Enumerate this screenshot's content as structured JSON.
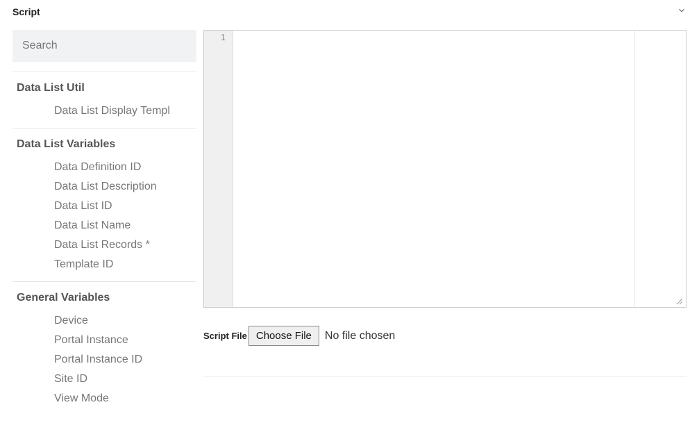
{
  "header": {
    "title": "Script"
  },
  "sidebar": {
    "search_placeholder": "Search",
    "groups": [
      {
        "title": "Data List Util",
        "items": [
          "Data List Display Templ"
        ]
      },
      {
        "title": "Data List Variables",
        "items": [
          "Data Definition ID",
          "Data List Description",
          "Data List ID",
          "Data List Name",
          "Data List Records *",
          "Template ID"
        ]
      },
      {
        "title": "General Variables",
        "items": [
          "Device",
          "Portal Instance",
          "Portal Instance ID",
          "Site ID",
          "View Mode"
        ]
      }
    ]
  },
  "editor": {
    "line_number": "1",
    "content": ""
  },
  "script_file": {
    "label": "Script File",
    "button_label": "Choose File",
    "status": "No file chosen"
  }
}
